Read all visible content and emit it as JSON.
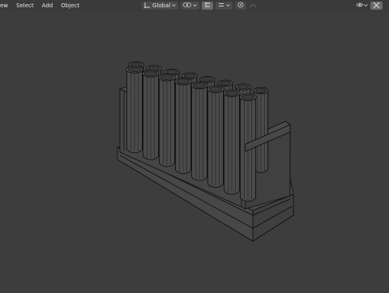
{
  "menu": {
    "view_label": "ew",
    "select_label": "Select",
    "add_label": "Add",
    "object_label": "Object"
  },
  "toolbar": {
    "transform_orientation": "Global",
    "icons": [
      "transform-orientation-icon",
      "pivot-icon",
      "snap-icon",
      "snap-increment-icon",
      "proportional-edit-icon",
      "proportional-falloff-icon"
    ]
  },
  "right_toolbar": {
    "icons": [
      "visibility-icon",
      "gizmo-icon"
    ]
  },
  "colors": {
    "header_bg": "#3a3a3a",
    "viewport_bg": "#3d3d3d",
    "wire": "#0c0c0c",
    "text": "#e6e6e6"
  },
  "scene": {
    "object": "test-tube-rack",
    "tube_count": 16,
    "shading": "wireframe-over-solid"
  }
}
